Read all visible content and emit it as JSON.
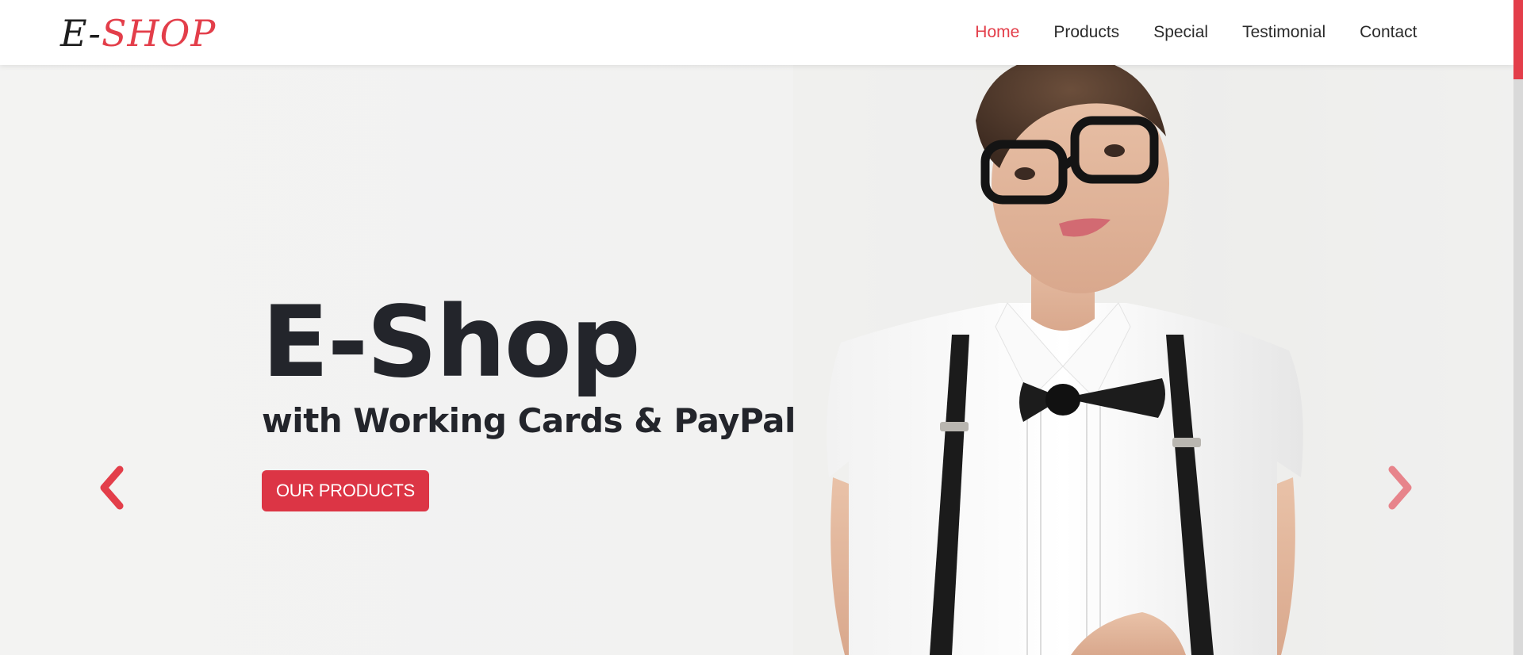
{
  "brand": {
    "prefix": "E-",
    "name": "SHOP"
  },
  "nav": {
    "items": [
      {
        "label": "Home",
        "active": true
      },
      {
        "label": "Products"
      },
      {
        "label": "Special"
      },
      {
        "label": "Testimonial"
      },
      {
        "label": "Contact"
      }
    ]
  },
  "hero": {
    "title": "E-Shop",
    "subtitle": "with Working Cards & PayPal",
    "cta": "OUR PRODUCTS"
  },
  "carousel": {
    "prev_icon": "chevron-left-icon",
    "next_icon": "chevron-right-icon"
  },
  "colors": {
    "accent": "#e33e4a",
    "button": "#dc3545",
    "text": "#23252b"
  }
}
